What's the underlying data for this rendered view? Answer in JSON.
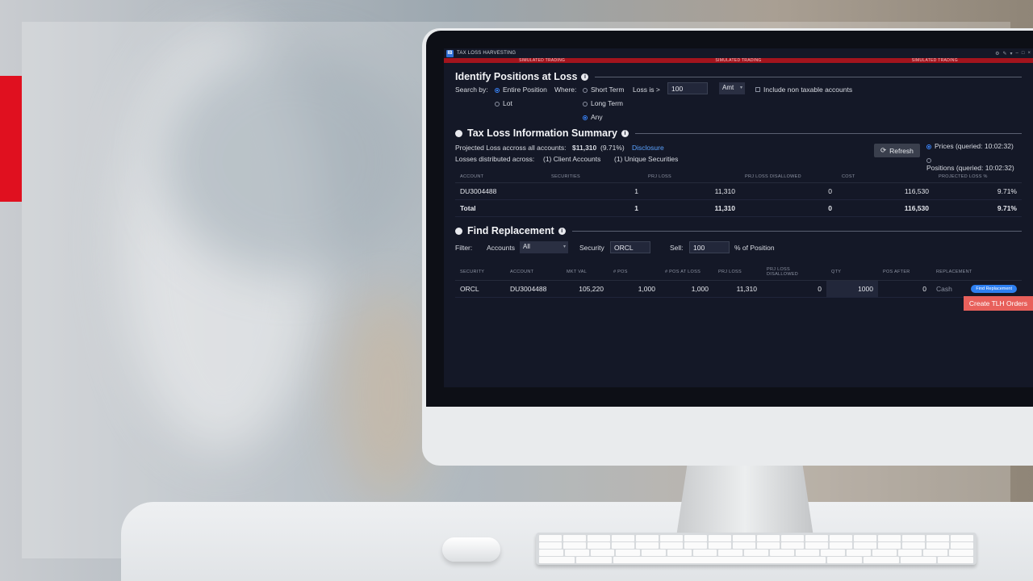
{
  "app": {
    "icon_letter": "IB",
    "window_title": "TAX LOSS HARVESTING",
    "simulated_trading_label": "SIMULATED TRADING",
    "window_controls": [
      "⚙",
      "✎",
      "▾",
      "–",
      "□",
      "×"
    ]
  },
  "identify": {
    "title": "Identify Positions at Loss",
    "search_by_label": "Search by:",
    "entire_position_label": "Entire Position",
    "lot_label": "Lot",
    "where_label": "Where:",
    "short_term_label": "Short Term",
    "long_term_label": "Long Term",
    "any_label": "Any",
    "loss_is_label": "Loss is >",
    "loss_value": "100",
    "amt_select": "Amt",
    "include_non_taxable_label": "Include non taxable accounts"
  },
  "summary": {
    "title": "Tax Loss Information Summary",
    "projected_loss_label": "Projected Loss accross all accounts:",
    "projected_loss_value": "$11,310",
    "projected_loss_pct": "(9.71%)",
    "disclosure_label": "Disclosure",
    "losses_distributed_label": "Losses distributed across:",
    "client_accounts": "(1) Client Accounts",
    "unique_securities": "(1) Unique Securities",
    "refresh_label": "Refresh",
    "prices_label": "Prices (queried: 10:02:32)",
    "positions_label": "Positions (queried: 10:02:32)",
    "table": {
      "headers": [
        "ACCOUNT",
        "SECURITIES",
        "PRJ LOSS",
        "PRJ LOSS DISALLOWED",
        "COST",
        "PROJECTED LOSS %"
      ],
      "rows": [
        [
          "DU3004488",
          "1",
          "11,310",
          "0",
          "116,530",
          "9.71%"
        ]
      ],
      "total": [
        "Total",
        "1",
        "11,310",
        "0",
        "116,530",
        "9.71%"
      ]
    }
  },
  "replacement": {
    "title": "Find Replacement",
    "filter_label": "Filter:",
    "accounts_label": "Accounts",
    "accounts_value": "All",
    "security_label": "Security",
    "security_value": "ORCL",
    "sell_label": "Sell:",
    "sell_value": "100",
    "pct_position_label": "% of Position",
    "table": {
      "headers": [
        "SECURITY",
        "ACCOUNT",
        "MKT VAL",
        "# POS",
        "# POS AT LOSS",
        "PRJ LOSS",
        "PRJ LOSS DISALLOWED",
        "QTY",
        "POS AFTER",
        "REPLACEMENT"
      ],
      "row": {
        "security": "ORCL",
        "account": "DU3004488",
        "mkt_val": "105,220",
        "pos": "1,000",
        "pos_at_loss": "1,000",
        "prj_loss": "11,310",
        "prj_loss_disallowed": "0",
        "qty": "1000",
        "pos_after": "0",
        "replacement": "Cash",
        "find_button": "Find Replacement"
      }
    },
    "create_button": "Create TLH Orders"
  }
}
